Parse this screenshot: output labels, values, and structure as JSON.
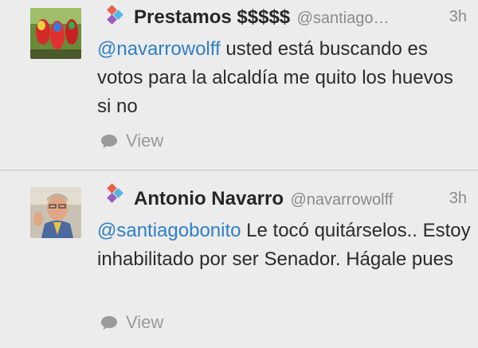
{
  "tweets": [
    {
      "name": "Prestamos $$$$$",
      "handle": "@santiago…",
      "time": "3h",
      "mention": "@navarrowolff",
      "text": " usted está buscando es votos para la alcaldía me quito los huevos si no",
      "action_label": "View",
      "avatar_icon": "parrots-photo",
      "badge_icon": "app-badge-icon"
    },
    {
      "name": "Antonio Navarro",
      "handle": "@navarrowolff",
      "time": "3h",
      "mention": "@santiagobonito",
      "text": " Le tocó quitárselos.. Estoy inhabilitado por ser Senador. Hágale pues",
      "action_label": "View",
      "avatar_icon": "man-portrait-photo",
      "badge_icon": "app-badge-icon"
    }
  ],
  "colors": {
    "background": "#ececec",
    "mention": "#2f7fc7",
    "meta": "#8a8a8a"
  }
}
